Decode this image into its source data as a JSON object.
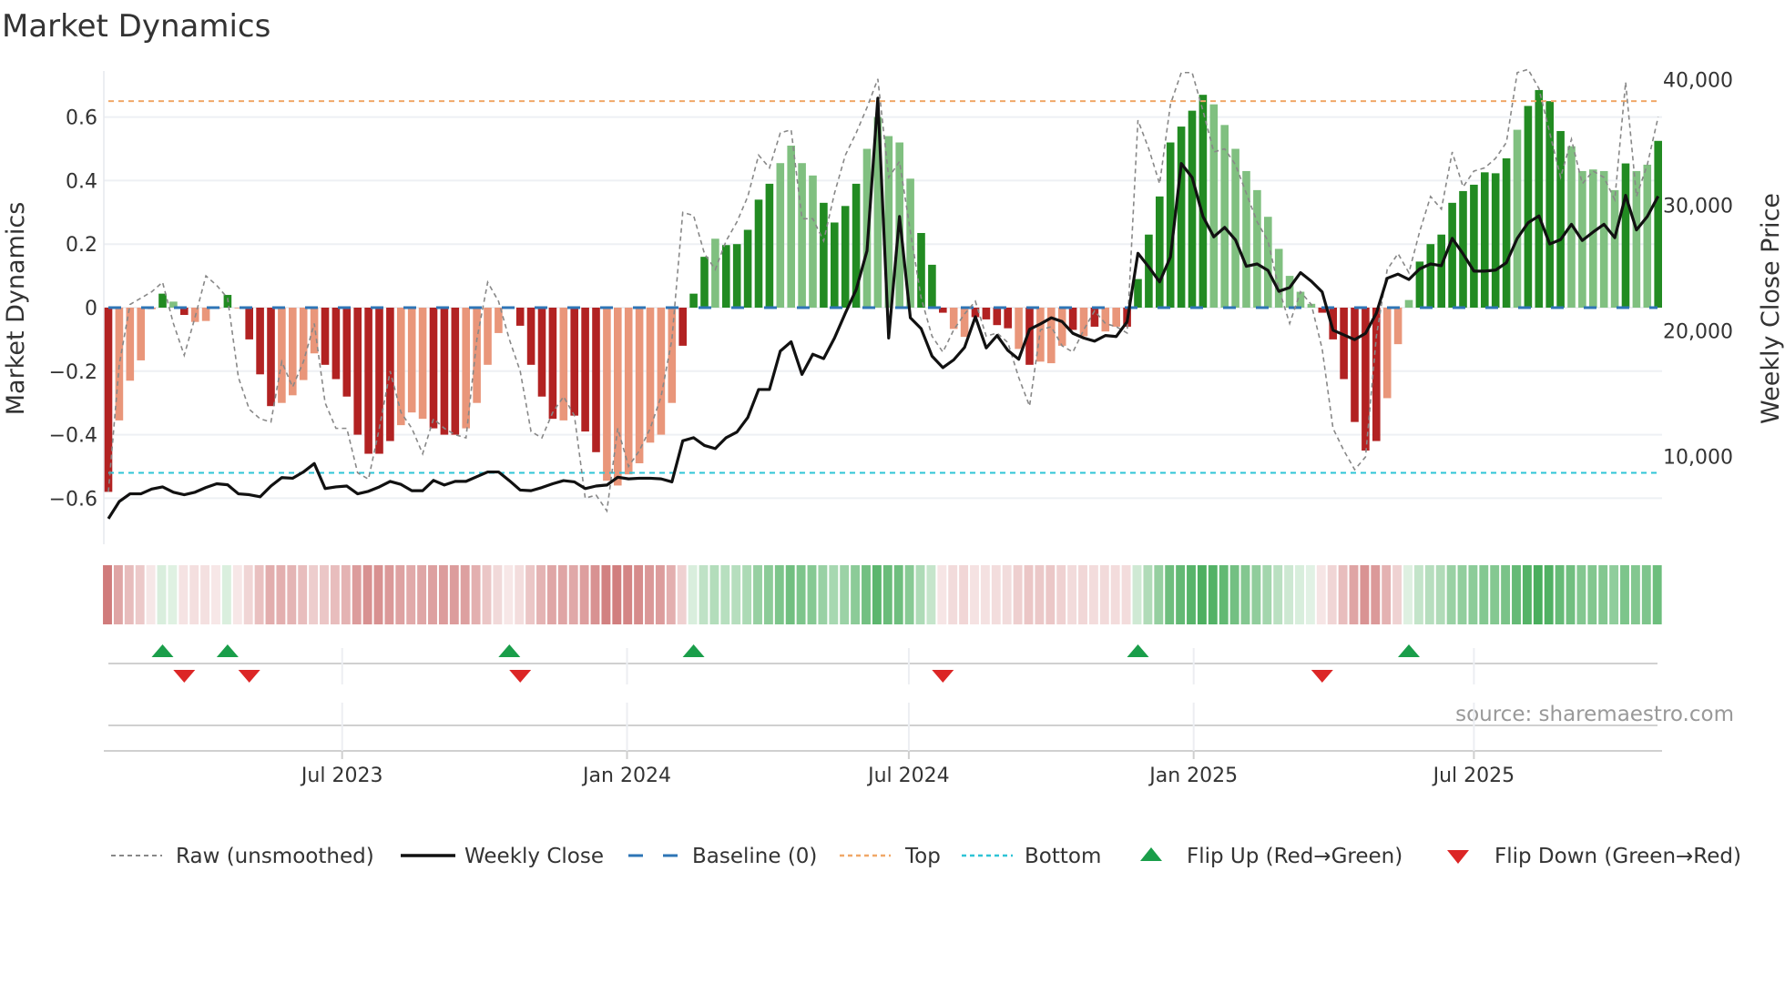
{
  "chart_data": {
    "type": "bar",
    "title": "Market Dynamics",
    "ylabel": "Market Dynamics",
    "y2label": "Weekly Close Price",
    "ylim": [
      -0.745,
      0.745
    ],
    "y2lim": [
      3000,
      40700
    ],
    "yticks": [
      -0.6,
      -0.4,
      -0.2,
      0,
      0.2,
      0.4,
      0.6
    ],
    "ytick_labels": [
      "−0.6",
      "−0.4",
      "−0.2",
      "0",
      "0.2",
      "0.4",
      "0.6"
    ],
    "y2ticks": [
      10000,
      20000,
      30000,
      40000
    ],
    "y2tick_labels": [
      "10,000",
      "20,000",
      "30,000",
      "40,000"
    ],
    "x_start": "2023-01-31",
    "x_step_days": 7,
    "xticks": [
      {
        "date": "2023-07-01",
        "label": "Jul 2023"
      },
      {
        "date": "2024-01-01",
        "label": "Jan 2024"
      },
      {
        "date": "2024-07-01",
        "label": "Jul 2024"
      },
      {
        "date": "2025-01-01",
        "label": "Jan 2025"
      },
      {
        "date": "2025-07-01",
        "label": "Jul 2025"
      }
    ],
    "top_level": 0.65,
    "bottom_level": -0.52,
    "baseline": 0,
    "dynamics": [
      -0.58,
      -0.355,
      -0.23,
      -0.166,
      -0.005,
      0.044,
      0.019,
      -0.023,
      -0.045,
      -0.042,
      -0.003,
      0.04,
      -0.002,
      -0.1,
      -0.21,
      -0.31,
      -0.3,
      -0.276,
      -0.228,
      -0.144,
      -0.18,
      -0.225,
      -0.28,
      -0.4,
      -0.46,
      -0.46,
      -0.42,
      -0.37,
      -0.33,
      -0.35,
      -0.38,
      -0.4,
      -0.4,
      -0.38,
      -0.3,
      -0.18,
      -0.08,
      -0.003,
      -0.057,
      -0.18,
      -0.28,
      -0.35,
      -0.355,
      -0.34,
      -0.39,
      -0.455,
      -0.545,
      -0.56,
      -0.525,
      -0.49,
      -0.425,
      -0.4,
      -0.3,
      -0.12,
      0.044,
      0.16,
      0.217,
      0.197,
      0.2,
      0.245,
      0.34,
      0.39,
      0.455,
      0.51,
      0.455,
      0.416,
      0.33,
      0.268,
      0.32,
      0.39,
      0.5,
      0.6,
      0.54,
      0.52,
      0.406,
      0.235,
      0.135,
      -0.016,
      -0.067,
      -0.092,
      -0.03,
      -0.037,
      -0.055,
      -0.065,
      -0.13,
      -0.18,
      -0.17,
      -0.175,
      -0.12,
      -0.07,
      -0.09,
      -0.06,
      -0.075,
      -0.06,
      -0.06,
      0.09,
      0.23,
      0.35,
      0.52,
      0.57,
      0.62,
      0.67,
      0.64,
      0.575,
      0.5,
      0.43,
      0.37,
      0.286,
      0.185,
      0.1,
      0.05,
      0.012,
      -0.016,
      -0.1,
      -0.225,
      -0.36,
      -0.45,
      -0.42,
      -0.285,
      -0.115,
      0.024,
      0.145,
      0.2,
      0.23,
      0.33,
      0.367,
      0.387,
      0.426,
      0.423,
      0.47,
      0.56,
      0.635,
      0.685,
      0.65,
      0.556,
      0.508,
      0.43,
      0.435,
      0.43,
      0.37,
      0.454,
      0.43,
      0.45,
      0.525
    ],
    "shade": "dlllldldllldldddlllldddddddllldddlllllddddldddllllllldddldddddllllddddllllldddllddddldllldldllddddddddllllllllllddddddllldddddddddlddddllllldlldldd",
    "raw_unsmoothed": [
      -0.58,
      -0.18,
      0.01,
      0.03,
      0.05,
      0.08,
      -0.05,
      -0.15,
      -0.03,
      0.1,
      0.07,
      0.03,
      -0.22,
      -0.32,
      -0.35,
      -0.36,
      -0.17,
      -0.25,
      -0.17,
      -0.05,
      -0.3,
      -0.38,
      -0.38,
      -0.52,
      -0.54,
      -0.38,
      -0.2,
      -0.33,
      -0.38,
      -0.46,
      -0.35,
      -0.38,
      -0.4,
      -0.41,
      -0.1,
      0.08,
      0.02,
      -0.1,
      -0.2,
      -0.39,
      -0.41,
      -0.33,
      -0.28,
      -0.34,
      -0.6,
      -0.59,
      -0.64,
      -0.38,
      -0.5,
      -0.45,
      -0.38,
      -0.28,
      -0.1,
      0.3,
      0.29,
      0.17,
      0.12,
      0.21,
      0.27,
      0.35,
      0.48,
      0.44,
      0.55,
      0.56,
      0.28,
      0.28,
      0.21,
      0.36,
      0.48,
      0.55,
      0.63,
      0.72,
      0.41,
      0.46,
      0.24,
      0.03,
      -0.09,
      -0.14,
      -0.07,
      -0.02,
      0.02,
      -0.09,
      -0.08,
      -0.11,
      -0.22,
      -0.31,
      -0.07,
      -0.06,
      -0.12,
      -0.14,
      -0.07,
      -0.01,
      -0.05,
      -0.06,
      -0.08,
      0.59,
      0.5,
      0.39,
      0.64,
      0.74,
      0.74,
      0.62,
      0.49,
      0.5,
      0.45,
      0.36,
      0.27,
      0.21,
      0.06,
      -0.05,
      0.05,
      0.01,
      -0.13,
      -0.38,
      -0.45,
      -0.51,
      -0.47,
      -0.09,
      0.12,
      0.17,
      0.11,
      0.24,
      0.35,
      0.31,
      0.49,
      0.38,
      0.43,
      0.44,
      0.47,
      0.52,
      0.74,
      0.75,
      0.69,
      0.55,
      0.41,
      0.53,
      0.39,
      0.43,
      0.41,
      0.34,
      0.71,
      0.35,
      0.45,
      0.6
    ],
    "weekly_close": [
      5040,
      6400,
      7020,
      7020,
      7400,
      7570,
      7150,
      6950,
      7150,
      7520,
      7820,
      7740,
      7020,
      6950,
      6780,
      7640,
      8310,
      8260,
      8760,
      9430,
      7440,
      7570,
      7640,
      7020,
      7220,
      7570,
      8010,
      7770,
      7270,
      7270,
      8090,
      7720,
      8010,
      8010,
      8390,
      8760,
      8760,
      8070,
      7320,
      7270,
      7520,
      7820,
      8070,
      7970,
      7440,
      7640,
      7720,
      8340,
      8210,
      8260,
      8260,
      8210,
      7970,
      11240,
      11490,
      10870,
      10620,
      11490,
      11940,
      13100,
      15330,
      15330,
      18390,
      19130,
      16530,
      18140,
      17790,
      19430,
      21410,
      23280,
      26380,
      38540,
      19430,
      29110,
      21040,
      20170,
      17990,
      17070,
      17690,
      18680,
      21120,
      18640,
      19630,
      18440,
      17740,
      20120,
      20550,
      21040,
      20740,
      19800,
      19430,
      19180,
      19630,
      19550,
      20720,
      26180,
      25090,
      23900,
      25880,
      33330,
      32220,
      29110,
      27490,
      28240,
      27250,
      25140,
      25330,
      24810,
      23150,
      23450,
      24640,
      23950,
      23100,
      20050,
      19680,
      19300,
      19800,
      21410,
      24190,
      24520,
      24090,
      24940,
      25330,
      25190,
      27370,
      26130,
      24760,
      24760,
      24840,
      25430,
      27370,
      28610,
      29160,
      26920,
      27270,
      28490,
      27200,
      27870,
      28490,
      27420,
      30790,
      28040,
      29110,
      30720
    ],
    "flip_up_dates": [
      "2023-03-07",
      "2023-04-18",
      "2023-10-17",
      "2024-02-13",
      "2024-11-26",
      "2025-05-20"
    ],
    "flip_down_dates": [
      "2023-03-21",
      "2023-05-02",
      "2023-10-24",
      "2024-07-23",
      "2025-03-25"
    ],
    "legend": [
      {
        "key": "raw",
        "label": "Raw (unsmoothed)"
      },
      {
        "key": "close",
        "label": "Weekly Close"
      },
      {
        "key": "baseline",
        "label": "Baseline (0)"
      },
      {
        "key": "top",
        "label": "Top"
      },
      {
        "key": "bottom",
        "label": "Bottom"
      },
      {
        "key": "flip_up",
        "label": "Flip Up (Red→Green)"
      },
      {
        "key": "flip_down",
        "label": "Flip Down (Green→Red)"
      }
    ],
    "legend_position": "bottom",
    "source": "source: sharemaestro.com",
    "colors": {
      "pos_dark": "#228b22",
      "pos_light": "#80c080",
      "neg_dark": "#b22222",
      "neg_light": "#e9967a",
      "raw": "#888888",
      "close": "#111111",
      "baseline": "#2e75b6",
      "top": "#f0a868",
      "bottom": "#2ec4d6",
      "flip_up": "#1a9e4a",
      "flip_down": "#dc2626"
    }
  }
}
